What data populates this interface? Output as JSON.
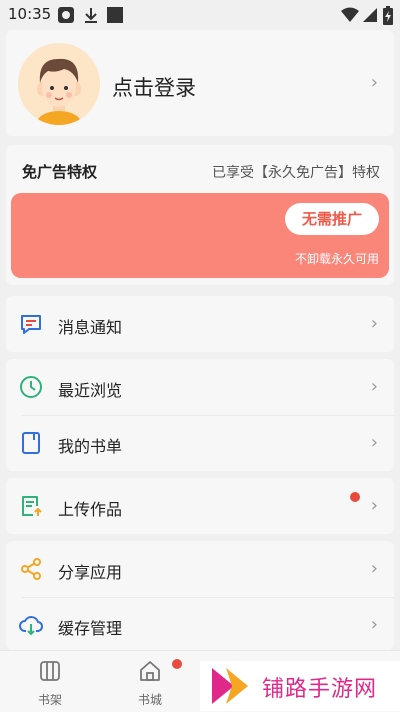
{
  "status_bar": {
    "time": "10:35"
  },
  "profile": {
    "login_text": "点击登录"
  },
  "ad_card": {
    "title": "免广告特权",
    "status": "已享受【永久免广告】特权",
    "button_label": "无需推广",
    "subtext": "不卸载永久可用",
    "banner_color": "#f98679"
  },
  "menu": {
    "notifications": "消息通知",
    "recent": "最近浏览",
    "booklist": "我的书单",
    "upload": "上传作品",
    "share": "分享应用",
    "cache": "缓存管理"
  },
  "bottom_nav": {
    "tabs": [
      {
        "label": "书架",
        "icon": "bookshelf-icon"
      },
      {
        "label": "书城",
        "icon": "bookstore-icon"
      }
    ]
  },
  "watermark": {
    "text": "铺路手游网"
  },
  "colors": {
    "accent_red": "#e84b3c",
    "accent_blue": "#2f6fe0",
    "accent_green": "#2fb37a",
    "accent_orange": "#f5a623"
  }
}
